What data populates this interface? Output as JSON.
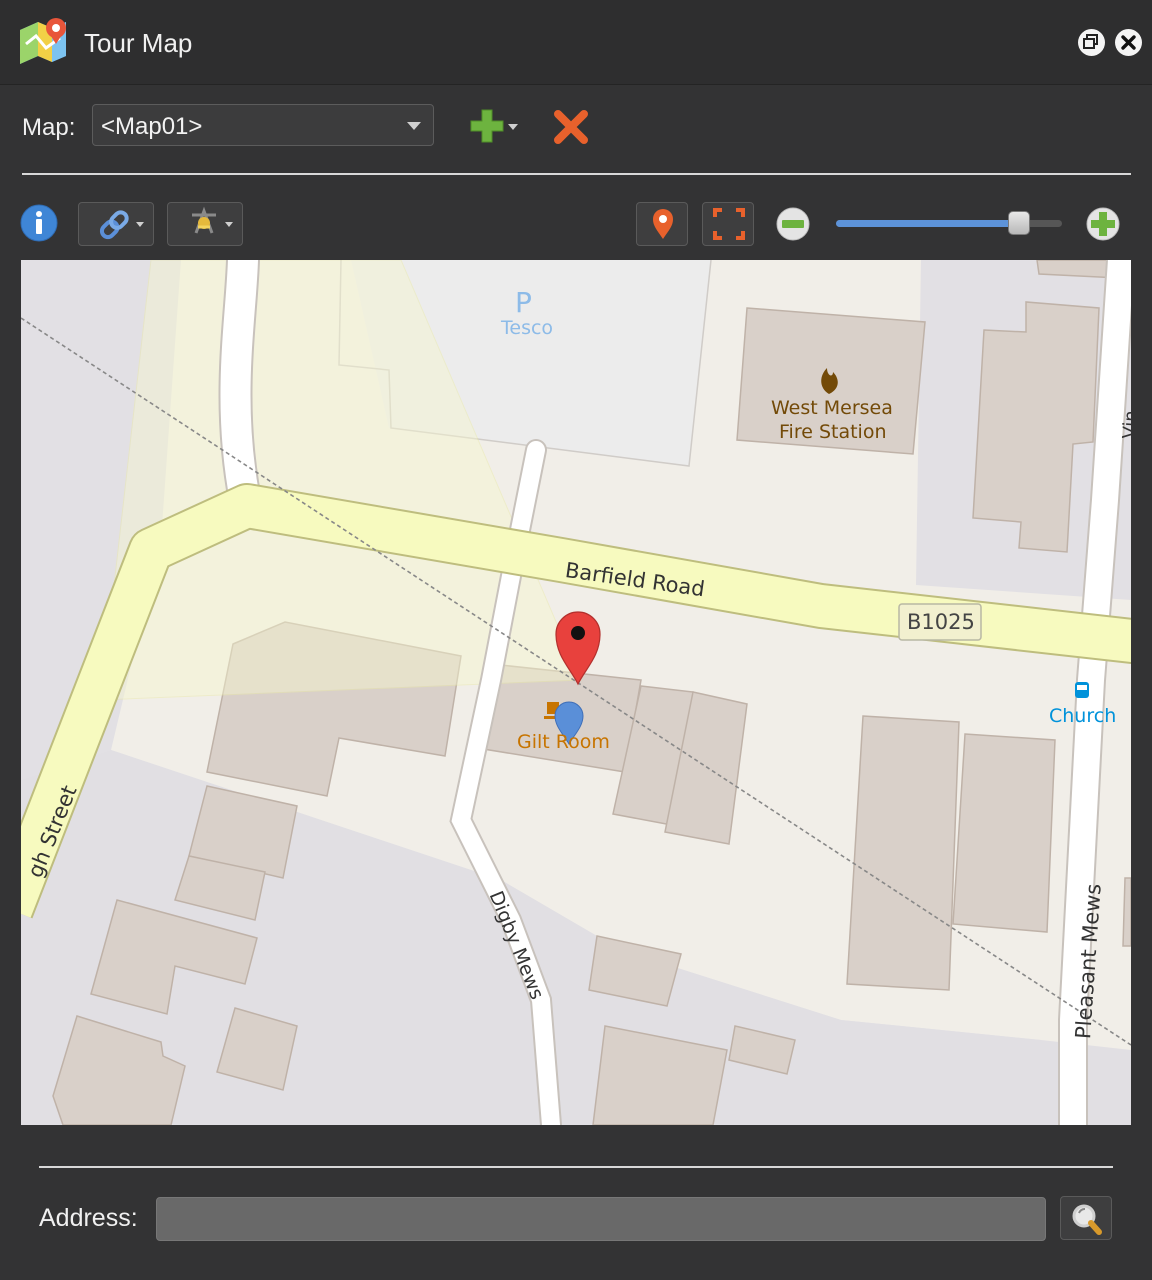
{
  "window": {
    "title": "Tour Map"
  },
  "map_selector": {
    "label": "Map:",
    "selected": "<Map01>"
  },
  "zoom": {
    "level_fraction": 0.81
  },
  "map": {
    "labels": {
      "parking_symbol": "P",
      "tesco": "Tesco",
      "fire_station_line1": "West Mersea",
      "fire_station_line2": "Fire Station",
      "barfield_road": "Barfield Road",
      "road_ref": "B1025",
      "church": "Church",
      "gilt_room": "Gilt Room",
      "high_street": "gh Street",
      "digby_mews": "Digby Mews",
      "pleasant_mews": "Pleasant Mews",
      "vine_road": "Vin"
    },
    "colors": {
      "land": "#f1eee8",
      "building": "#d9d0c9",
      "road_primary": "#f7fabf",
      "road_minor": "#ffffff",
      "poi_food": "#c77400",
      "poi_fire": "#734a08",
      "poi_transit": "#0092da",
      "poi_parking": "#6fa6e0"
    }
  },
  "address": {
    "label": "Address:",
    "value": "",
    "placeholder": ""
  }
}
